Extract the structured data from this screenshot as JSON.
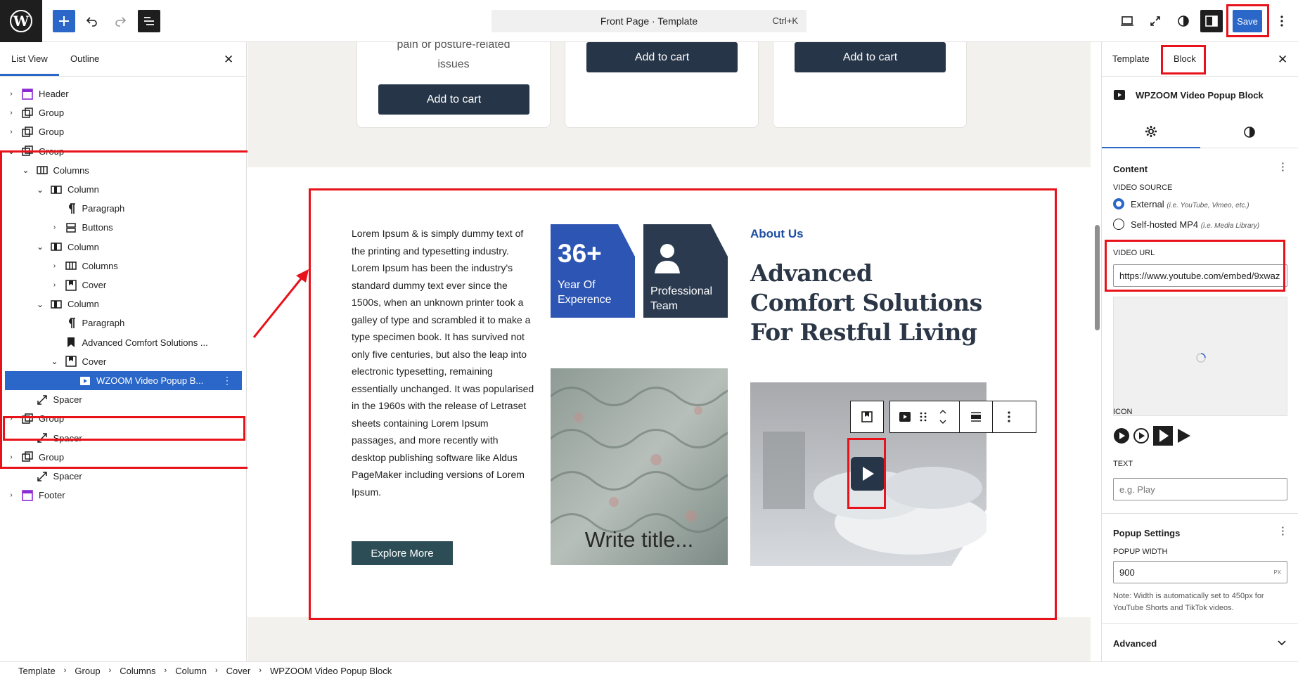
{
  "topbar": {
    "command_title": "Front Page · Template",
    "command_shortcut": "Ctrl+K",
    "save_label": "Save",
    "accent": "#2b67c9"
  },
  "listview": {
    "tab_list": "List View",
    "tab_outline": "Outline",
    "rows": [
      {
        "label": "Header",
        "icon": "template-part-icon"
      },
      {
        "label": "Group",
        "icon": "group-icon"
      },
      {
        "label": "Group",
        "icon": "group-icon"
      },
      {
        "label": "Group",
        "icon": "group-icon"
      },
      {
        "label": "Columns",
        "icon": "columns-icon"
      },
      {
        "label": "Column",
        "icon": "column-icon"
      },
      {
        "label": "Paragraph",
        "icon": "paragraph-icon"
      },
      {
        "label": "Buttons",
        "icon": "buttons-icon"
      },
      {
        "label": "Column",
        "icon": "column-icon"
      },
      {
        "label": "Columns",
        "icon": "columns-icon"
      },
      {
        "label": "Cover",
        "icon": "cover-icon"
      },
      {
        "label": "Column",
        "icon": "column-icon"
      },
      {
        "label": "Paragraph",
        "icon": "paragraph-icon"
      },
      {
        "label": "Advanced Comfort Solutions ...",
        "icon": "bookmark-icon"
      },
      {
        "label": "Cover",
        "icon": "cover-icon"
      },
      {
        "label": "WZOOM Video Popup B...",
        "icon": "video-icon"
      },
      {
        "label": "Spacer",
        "icon": "spacer-icon"
      },
      {
        "label": "Group",
        "icon": "group-icon"
      },
      {
        "label": "Spacer",
        "icon": "spacer-icon"
      },
      {
        "label": "Group",
        "icon": "group-icon"
      },
      {
        "label": "Spacer",
        "icon": "spacer-icon"
      },
      {
        "label": "Footer",
        "icon": "template-part-icon"
      }
    ]
  },
  "canvas": {
    "product_text": [
      "pain or posture-related",
      "issues"
    ],
    "add_to_cart": "Add to cart",
    "lorem": "Lorem Ipsum & is simply dummy text of the printing and typesetting industry. Lorem Ipsum has been the industry's standard dummy text ever since the 1500s, when an unknown printer took a galley of type and scrambled it to make a type specimen book. It has survived not only five centuries, but also the leap into electronic typesetting, remaining essentially unchanged. It was popularised in the 1960s with the release of Letraset sheets containing Lorem Ipsum passages, and more recently with desktop publishing software like Aldus PageMaker including versions of Lorem Ipsum.",
    "explore_label": "Explore More",
    "stat_number": "36+",
    "stat_label": "Year Of Experence",
    "team_label": "Professional Team",
    "about": "About Us",
    "headline": "Advanced Comfort Solutions For Restful Living",
    "write_title": "Write title..."
  },
  "sidebar": {
    "tab_template": "Template",
    "tab_block": "Block",
    "block_name": "WPZOOM Video Popup Block",
    "content_title": "Content",
    "video_source_label": "VIDEO SOURCE",
    "source_external": "External",
    "source_external_hint": "(i.e. YouTube, Vimeo, etc.)",
    "source_self": "Self-hosted MP4",
    "source_self_hint": "(i.e. Media Library)",
    "video_url_label": "VIDEO URL",
    "video_url_value": "https://www.youtube.com/embed/9xwaz",
    "icon_label": "ICON",
    "text_label": "TEXT",
    "text_placeholder": "e.g. Play",
    "popup_title": "Popup Settings",
    "popup_width_label": "POPUP WIDTH",
    "popup_width_value": "900",
    "popup_width_unit": "PX",
    "popup_note": "Note: Width is automatically set to 450px for YouTube Shorts and TikTok videos.",
    "advanced_title": "Advanced"
  },
  "breadcrumb": [
    "Template",
    "Group",
    "Columns",
    "Column",
    "Cover",
    "WPZOOM Video Popup Block"
  ]
}
